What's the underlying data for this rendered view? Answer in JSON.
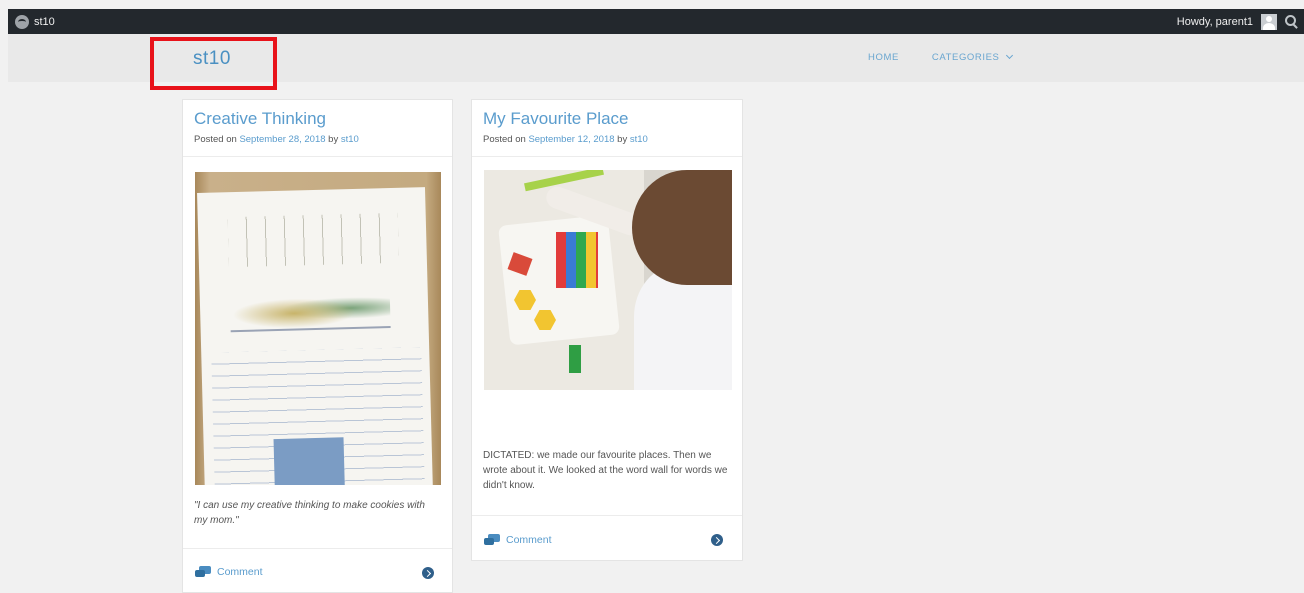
{
  "admin_bar": {
    "site_name": "st10",
    "greeting": "Howdy, parent1",
    "icons": [
      "wordpress-dashboard-icon",
      "avatar",
      "search-icon"
    ]
  },
  "header": {
    "site_title": "st10",
    "nav": [
      {
        "label": "HOME"
      },
      {
        "label": "CATEGORIES",
        "has_dropdown": true
      }
    ]
  },
  "posts": [
    {
      "title": "Creative Thinking",
      "posted_on_prefix": "Posted on",
      "date": "September 28, 2018",
      "by_text": "by",
      "author": "st10",
      "excerpt": "\"I can use my creative thinking to make cookies with my mom.\"",
      "comment_label": "Comment"
    },
    {
      "title": "My Favourite Place",
      "posted_on_prefix": "Posted on",
      "date": "September 12, 2018",
      "by_text": "by",
      "author": "st10",
      "excerpt": "DICTATED: we made our favourite places. Then we wrote about it. We looked at the word wall for words we didn't know.",
      "comment_label": "Comment"
    }
  ],
  "colors": {
    "admin_bar_bg": "#23282d",
    "link": "#5a9ccd",
    "highlight_box": "#e8121a",
    "page_bg": "#f1f1f1"
  }
}
